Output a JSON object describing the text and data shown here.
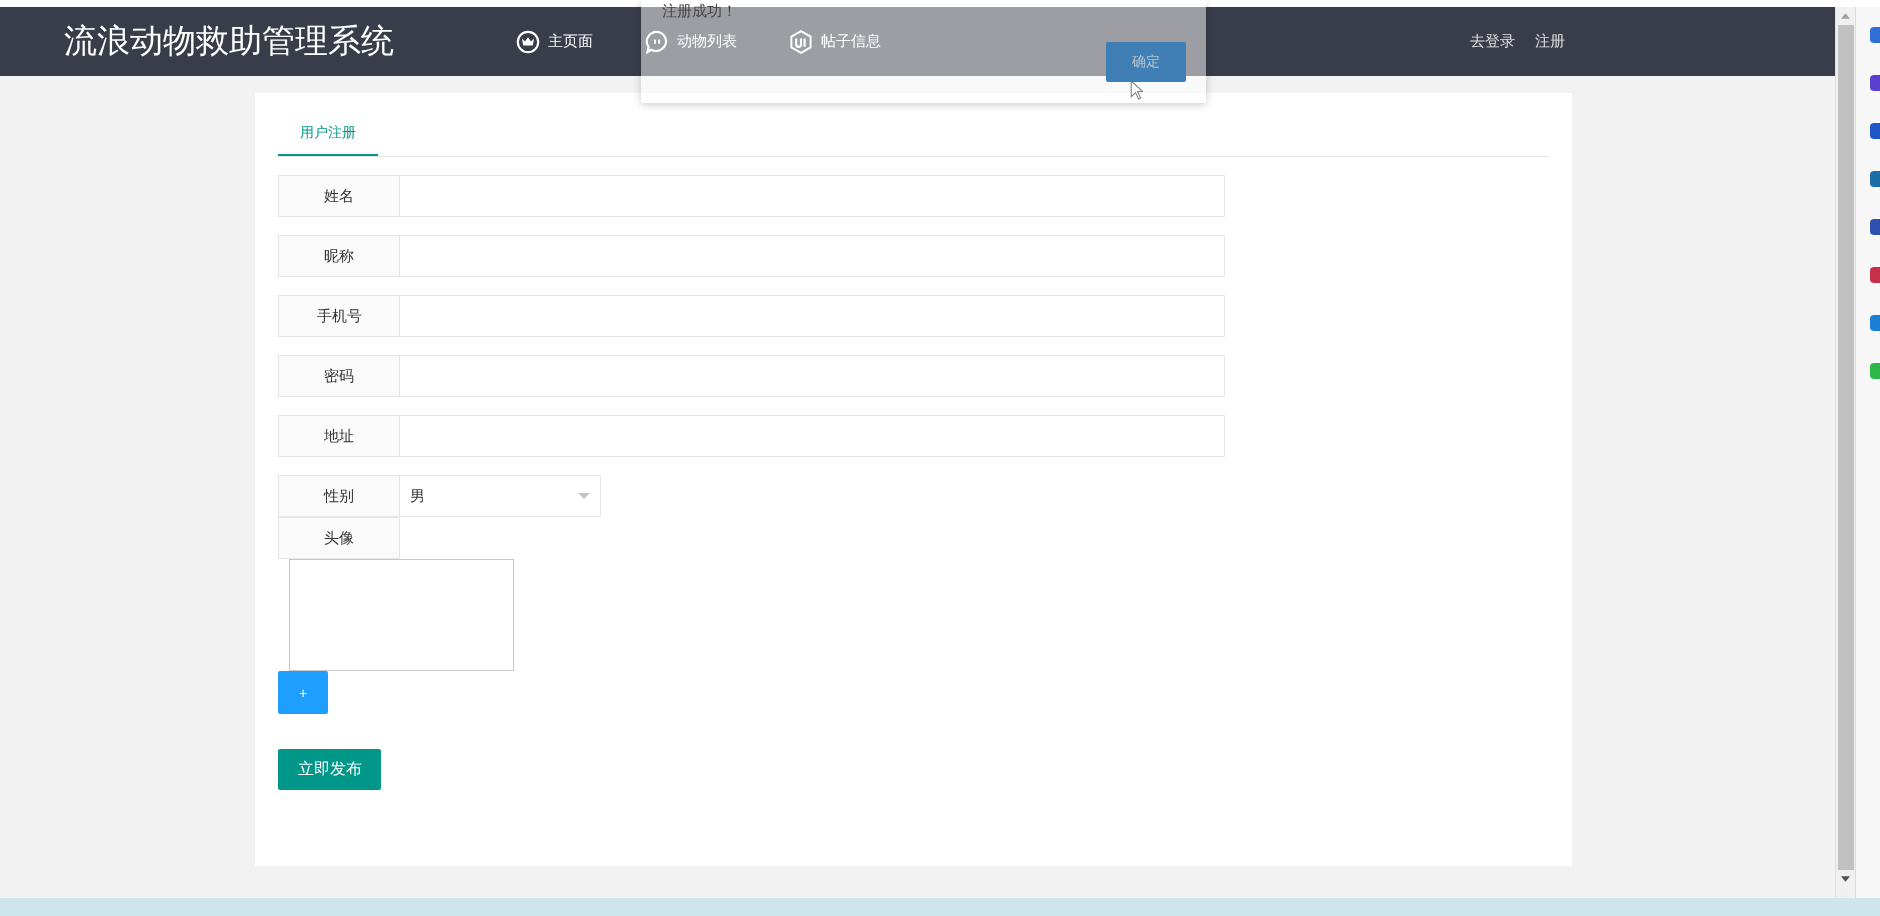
{
  "header": {
    "title": "流浪动物救助管理系统",
    "nav": [
      {
        "label": "主页面"
      },
      {
        "label": "动物列表"
      },
      {
        "label": "帖子信息"
      }
    ],
    "links": [
      "去登录",
      "注册"
    ]
  },
  "dialog": {
    "message": "注册成功！",
    "button": "确定"
  },
  "tabs": [
    {
      "label": "用户注册",
      "selected": true
    }
  ],
  "form": {
    "fields": [
      {
        "label": "姓名",
        "kind": "text"
      },
      {
        "label": "昵称",
        "kind": "text"
      },
      {
        "label": "手机号",
        "kind": "text"
      },
      {
        "label": "密码",
        "kind": "text"
      },
      {
        "label": "地址",
        "kind": "text"
      },
      {
        "label": "性别",
        "kind": "select",
        "value": "男"
      },
      {
        "label": "头像",
        "kind": "image"
      }
    ],
    "add_button": "+",
    "submit": "立即发布"
  }
}
